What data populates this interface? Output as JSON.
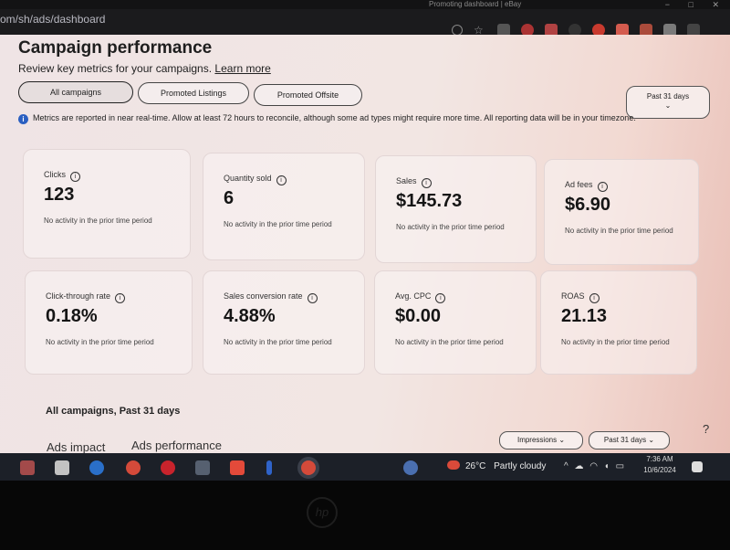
{
  "browser": {
    "tab_title": "Promoting dashboard | eBay",
    "url": "om/sh/ads/dashboard",
    "window_controls": [
      "−",
      "□",
      "✕"
    ]
  },
  "header": {
    "title": "Campaign performance",
    "subtitle": "Review key metrics for your campaigns.",
    "learn_more": "Learn more"
  },
  "filters": {
    "tabs": [
      {
        "label": "All campaigns",
        "active": true
      },
      {
        "label": "Promoted Listings",
        "active": false
      },
      {
        "label": "Promoted Offsite",
        "active": false
      }
    ],
    "date_range": "Past 31 days"
  },
  "notice": "Metrics are reported in near real-time. Allow at least 72 hours to reconcile, although some ad types might require more time. All reporting data will be in your timezone.",
  "metrics": [
    {
      "label": "Clicks",
      "value": "123",
      "note": "No activity in the prior time period"
    },
    {
      "label": "Quantity sold",
      "value": "6",
      "note": "No activity in the prior time period"
    },
    {
      "label": "Sales",
      "value": "$145.73",
      "note": "No activity in the prior time period"
    },
    {
      "label": "Ad fees",
      "value": "$6.90",
      "note": "No activity in the prior time period"
    },
    {
      "label": "Click-through rate",
      "value": "0.18%",
      "note": "No activity in the prior time period"
    },
    {
      "label": "Sales conversion rate",
      "value": "4.88%",
      "note": "No activity in the prior time period"
    },
    {
      "label": "Avg. CPC",
      "value": "$0.00",
      "note": "No activity in the prior time period"
    },
    {
      "label": "ROAS",
      "value": "21.13",
      "note": "No activity in the prior time period"
    }
  ],
  "section": {
    "summary": "All campaigns, Past 31 days",
    "tabs": [
      "Ads impact",
      "Ads performance"
    ],
    "metric_dropdown": "Impressions",
    "date_dropdown": "Past 31 days",
    "help": "?"
  },
  "taskbar": {
    "weather": "26°C",
    "weather_text": "Partly cloudy",
    "time": "7:36 AM",
    "date": "10/6/2024"
  },
  "colors": {
    "info_icon": "#2a5fc1",
    "page_bg": "#f2e6e3",
    "taskbar_bg": "#1c2028"
  }
}
